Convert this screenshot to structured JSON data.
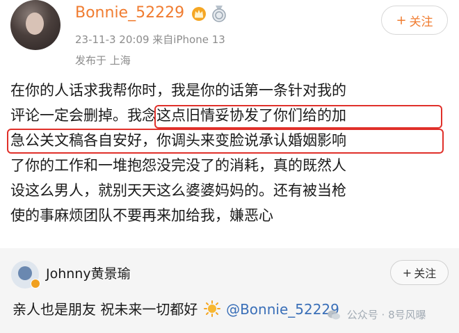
{
  "post": {
    "username": "Bonnie_52229",
    "meta": "23-11-3 20:09  来自iPhone 13",
    "location": "发布于 上海",
    "follow_label": "关注",
    "follow_plus": "+",
    "lines": [
      "在你的人话求我帮你时，我是你的话第一条针对我的",
      "评论一定会删掉。我念这点旧情妥协发了你们给的加",
      "急公关文稿各自安好，你调头来变脸说承认婚姻影响",
      "了你的工作和一堆抱怨没完没了的消耗，真的既然人",
      "设这么男人，就别天天这么婆婆妈妈的。还有被当枪",
      "使的事麻烦团队不要再来加给我，嫌恶心"
    ]
  },
  "comment": {
    "username": "Johnny黄景瑜",
    "follow_label": "关注",
    "follow_plus": "+",
    "text_before": "亲人也是朋友 祝未来一切都好",
    "mention": "@Bonnie_52229"
  },
  "watermark": {
    "text": "公众号 · 8号风曝"
  },
  "colors": {
    "accent_orange": "#f07c30",
    "highlight_red": "#e0302a",
    "mention_blue": "#3a6fb8"
  },
  "icons": {
    "crown": "crown-icon",
    "medal": "medal-icon",
    "sun": "sun-icon",
    "verified": "verified-badge-icon"
  }
}
